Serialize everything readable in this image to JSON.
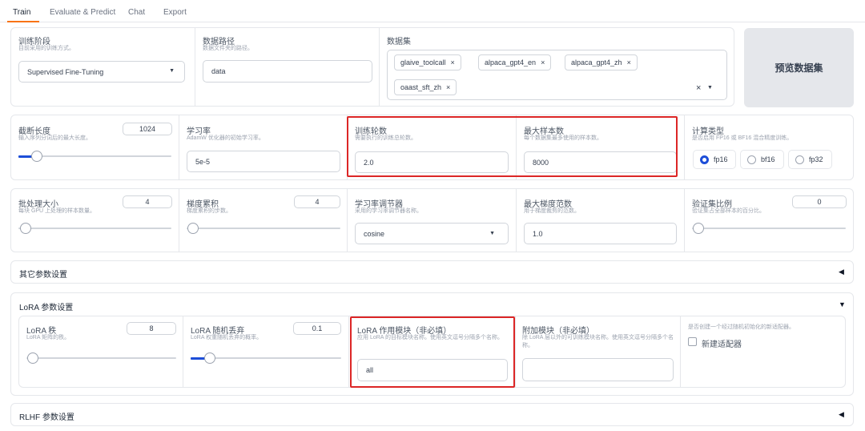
{
  "tabs": [
    "Train",
    "Evaluate & Predict",
    "Chat",
    "Export"
  ],
  "row1": {
    "stage": {
      "label": "训练阶段",
      "info": "目前采用的训练方式。",
      "value": "Supervised Fine-Tuning"
    },
    "path": {
      "label": "数据路径",
      "info": "数据文件夹的路径。",
      "value": "data"
    },
    "dataset": {
      "label": "数据集",
      "chips": [
        "glaive_toolcall",
        "alpaca_gpt4_en",
        "alpaca_gpt4_zh",
        "oaast_sft_zh"
      ],
      "clear": "×"
    },
    "preview_button": "预览数据集"
  },
  "row2": {
    "cutoff": {
      "label": "截断长度",
      "info": "输入序列分词后的最大长度。",
      "value": "1024"
    },
    "lr": {
      "label": "学习率",
      "info": "AdamW 优化器的初始学习率。",
      "value": "5e-5"
    },
    "epochs": {
      "label": "训练轮数",
      "info": "需要执行的训练总轮数。",
      "value": "2.0"
    },
    "max_samples": {
      "label": "最大样本数",
      "info": "每个数据集最多使用的样本数。",
      "value": "8000"
    },
    "compute": {
      "label": "计算类型",
      "info": "是否启用 FP16 或 BF16 混合精度训练。",
      "options": [
        "fp16",
        "bf16",
        "fp32"
      ],
      "selected": "fp16"
    }
  },
  "row3": {
    "batch": {
      "label": "批处理大小",
      "info": "每块 GPU 上处理的样本数量。",
      "value": "4"
    },
    "grad_acc": {
      "label": "梯度累积",
      "info": "梯度累积的步数。",
      "value": "4"
    },
    "scheduler": {
      "label": "学习率调节器",
      "info": "采用的学习率调节器名称。",
      "value": "cosine"
    },
    "max_grad": {
      "label": "最大梯度范数",
      "info": "用于梯度裁剪的范数。",
      "value": "1.0"
    },
    "val_size": {
      "label": "验证集比例",
      "info": "验证集占全部样本的百分比。",
      "value": "0"
    }
  },
  "sections": {
    "other": "其它参数设置",
    "lora": "LoRA 参数设置",
    "rlhf": "RLHF 参数设置"
  },
  "lora": {
    "rank": {
      "label": "LoRA 秩",
      "info": "LoRA 矩阵的秩。",
      "value": "8"
    },
    "dropout": {
      "label": "LoRA 随机丢弃",
      "info": "LoRA 权重随机丢弃的概率。",
      "value": "0.1"
    },
    "target": {
      "label": "LoRA 作用模块（非必填）",
      "info": "应用 LoRA 的目标模块名称。使用英文逗号分隔多个名称。",
      "value": "all"
    },
    "extra": {
      "label": "附加模块（非必填）",
      "info": "除 LoRA 层以外的可训练模块名称。使用英文逗号分隔多个名称。",
      "value": ""
    },
    "new_adapter": {
      "info": "是否创建一个经过随机初始化的新适配器。",
      "label": "新建适配器"
    }
  },
  "icons": {
    "collapsed": "◀",
    "expanded": "▼",
    "dropdown": "▼"
  },
  "colors": {
    "accent": "#1d4ed8",
    "highlight": "#dc2626",
    "tab_underline": "#f97316"
  }
}
